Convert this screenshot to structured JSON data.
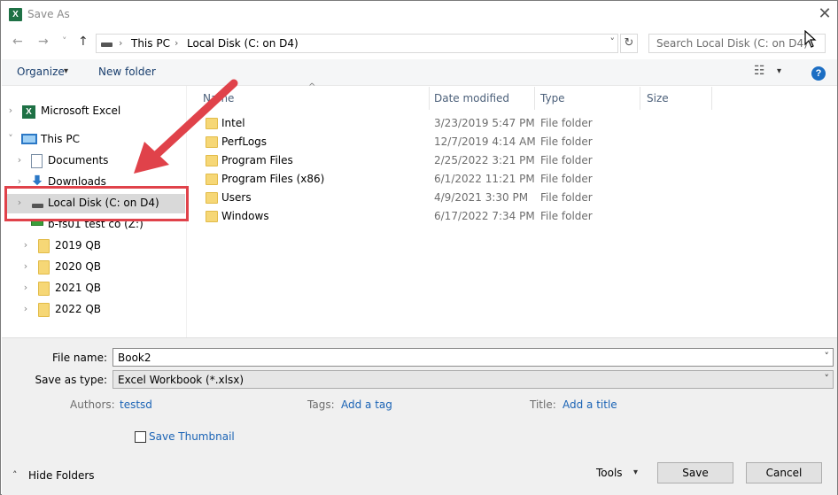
{
  "window": {
    "title": "Save As",
    "app_icon": "X",
    "close_glyph": "✕"
  },
  "nav": {
    "back_glyph": "←",
    "forward_glyph": "→",
    "recent_glyph": "˅",
    "up_glyph": "↑",
    "breadcrumb": [
      "This PC",
      "Local Disk (C: on D4)"
    ],
    "separator": "›",
    "dropdown_glyph": "˅",
    "refresh_glyph": "↻",
    "search_placeholder": "Search Local Disk (C: on D4)"
  },
  "toolbar": {
    "organize": "Organize",
    "organize_arrow": "▾",
    "new_folder": "New folder",
    "view_glyph": "☷",
    "view_arrow": "▾",
    "help": "?"
  },
  "tree": [
    {
      "label": "Microsoft Excel",
      "exp": "›"
    },
    {
      "label": "This PC",
      "exp": "˅"
    },
    {
      "label": "Documents",
      "exp": "›"
    },
    {
      "label": "Downloads",
      "exp": "›"
    },
    {
      "label": "Local Disk (C: on D4)",
      "exp": "›"
    },
    {
      "label": "b-fs01 test co (Z:)",
      "exp": "˅"
    },
    {
      "label": "2019 QB",
      "exp": "›"
    },
    {
      "label": "2020 QB",
      "exp": "›"
    },
    {
      "label": "2021 QB",
      "exp": "›"
    },
    {
      "label": "2022 QB",
      "exp": "›"
    }
  ],
  "columns": {
    "name": "Name",
    "sort_glyph": "^",
    "date": "Date modified",
    "type": "Type",
    "size": "Size"
  },
  "files": [
    {
      "name": "Intel",
      "date": "3/23/2019 5:47 PM",
      "type": "File folder"
    },
    {
      "name": "PerfLogs",
      "date": "12/7/2019 4:14 AM",
      "type": "File folder"
    },
    {
      "name": "Program Files",
      "date": "2/25/2022 3:21 PM",
      "type": "File folder"
    },
    {
      "name": "Program Files (x86)",
      "date": "6/1/2022 11:21 PM",
      "type": "File folder"
    },
    {
      "name": "Users",
      "date": "4/9/2021 3:30 PM",
      "type": "File folder"
    },
    {
      "name": "Windows",
      "date": "6/17/2022 7:34 PM",
      "type": "File folder"
    }
  ],
  "form": {
    "file_name_label": "File name:",
    "file_name_value": "Book2",
    "type_label": "Save as type:",
    "type_value": "Excel Workbook (*.xlsx)",
    "authors_label": "Authors:",
    "authors_value": "testsd",
    "tags_label": "Tags:",
    "tags_value": "Add a tag",
    "title_label": "Title:",
    "title_value": "Add a title",
    "thumbnail_label": "Save Thumbnail",
    "chevron": "˅"
  },
  "footer": {
    "hide_folders": "Hide Folders",
    "hide_glyph": "˄",
    "tools": "Tools",
    "tools_arrow": "▾",
    "save": "Save",
    "cancel": "Cancel"
  },
  "colors": {
    "highlight": "#e0424a",
    "link": "#1a63b5",
    "accent": "#1c6ec3"
  }
}
